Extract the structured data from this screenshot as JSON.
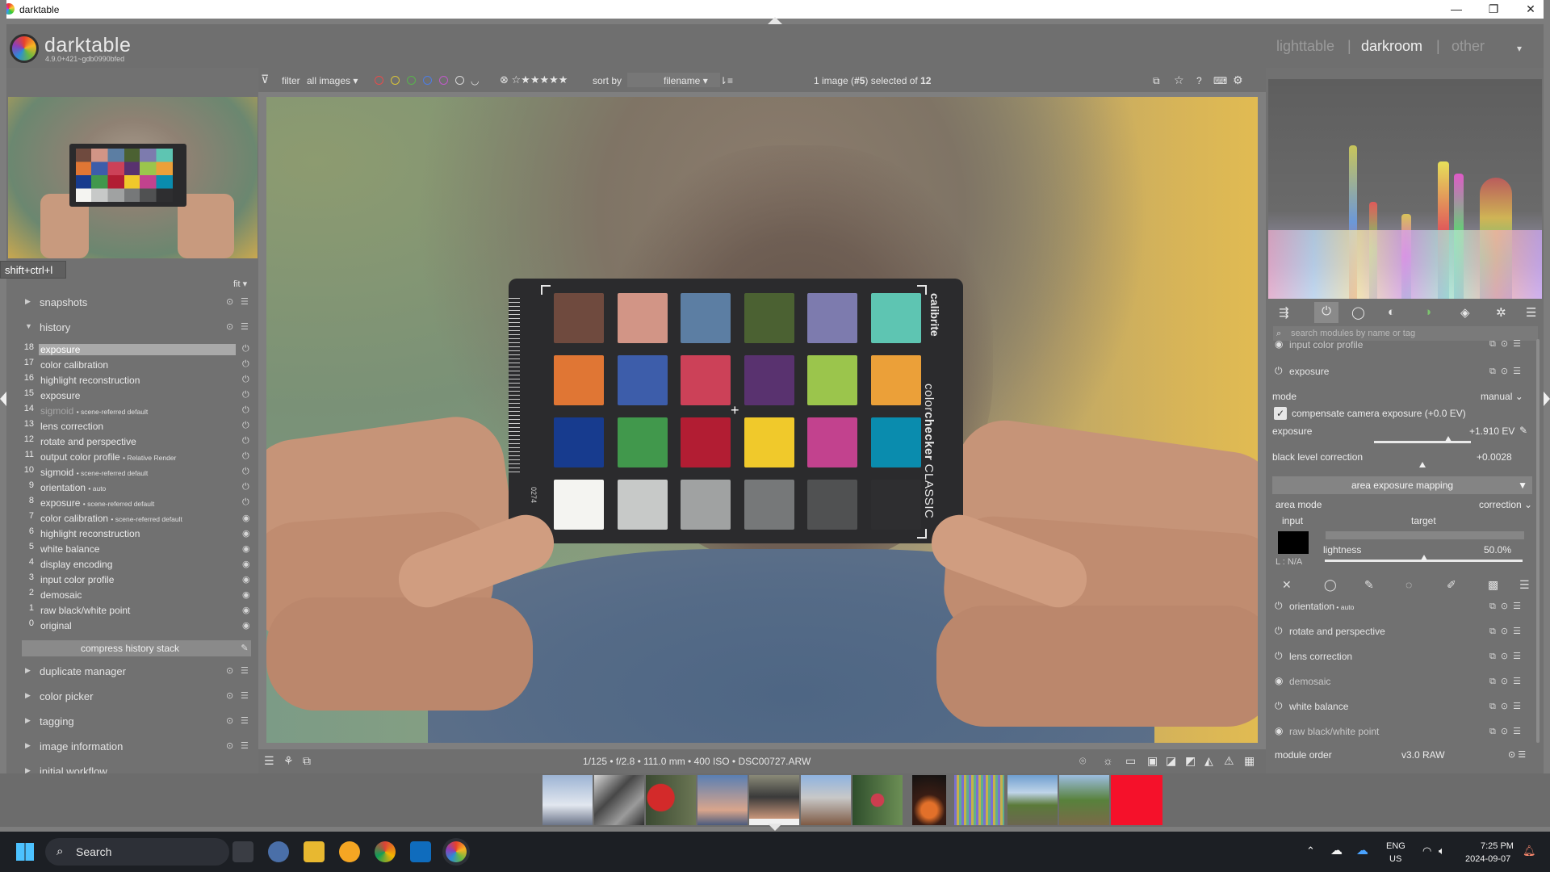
{
  "window": {
    "title": "darktable",
    "minimize": "—",
    "maximize": "❐",
    "close": "✕"
  },
  "header": {
    "app_name": "darktable",
    "version": "4.9.0+421~gdb0990bfed",
    "views": [
      "lighttable",
      "darkroom",
      "other"
    ],
    "active_view": "darkroom",
    "menu_icon": "▾"
  },
  "toolbar": {
    "filter_label": "filter",
    "filter_value": "all images",
    "sort_label": "sort by",
    "sort_value": "filename",
    "selection_prefix": "1 image (",
    "selection_num": "#5",
    "selection_mid": ") selected of ",
    "selection_total": "12",
    "color_labels": [
      "#e44d4d",
      "#d8c43a",
      "#59b44c",
      "#4d7de4",
      "#c05ac9"
    ],
    "stars": "☆★★★★★"
  },
  "left": {
    "tooltip": "shift+ctrl+l",
    "zoom": "fit",
    "snapshots": "snapshots",
    "history_title": "history",
    "history": [
      {
        "n": "18",
        "label": "exposure",
        "detail": "",
        "selected": true
      },
      {
        "n": "17",
        "label": "color calibration",
        "detail": ""
      },
      {
        "n": "16",
        "label": "highlight reconstruction",
        "detail": ""
      },
      {
        "n": "15",
        "label": "exposure",
        "detail": ""
      },
      {
        "n": "14",
        "label": "sigmoid",
        "detail": "scene-referred default",
        "dim": true
      },
      {
        "n": "13",
        "label": "lens correction",
        "detail": ""
      },
      {
        "n": "12",
        "label": "rotate and perspective",
        "detail": ""
      },
      {
        "n": "11",
        "label": "output color profile",
        "detail": "Relative Render"
      },
      {
        "n": "10",
        "label": "sigmoid",
        "detail": "scene-referred default"
      },
      {
        "n": "9",
        "label": "orientation",
        "detail": "auto"
      },
      {
        "n": "8",
        "label": "exposure",
        "detail": "scene-referred default"
      },
      {
        "n": "7",
        "label": "color calibration",
        "detail": "scene-referred default"
      },
      {
        "n": "6",
        "label": "highlight reconstruction",
        "detail": ""
      },
      {
        "n": "5",
        "label": "white balance",
        "detail": ""
      },
      {
        "n": "4",
        "label": "display encoding",
        "detail": ""
      },
      {
        "n": "3",
        "label": "input color profile",
        "detail": ""
      },
      {
        "n": "2",
        "label": "demosaic",
        "detail": ""
      },
      {
        "n": "1",
        "label": "raw black/white point",
        "detail": ""
      },
      {
        "n": "0",
        "label": "original",
        "detail": ""
      }
    ],
    "compress": "compress history stack",
    "collapsed_modules": [
      "duplicate manager",
      "color picker",
      "tagging",
      "image information",
      "initial workflow"
    ]
  },
  "bottom_info": "1/125 • f/2.8 • 111.0 mm • 400 ISO • DSC00727.ARW",
  "card": {
    "brand": "calibrite",
    "title_light": "color",
    "title_bold": "checker",
    "title_suffix": " CLASSIC",
    "number": "0274",
    "swatches": [
      [
        "#6f4a3e",
        "#d29586",
        "#5c7ea3",
        "#4b6132",
        "#7d7bae",
        "#5ec5b2"
      ],
      [
        "#e07634",
        "#3d5daa",
        "#cc4158",
        "#59326f",
        "#9bc54c",
        "#eba039"
      ],
      [
        "#173b8e",
        "#41984c",
        "#b21d33",
        "#f0c92b",
        "#c2428e",
        "#0a8cae"
      ],
      [
        "#f4f4f1",
        "#c7c9c8",
        "#a0a2a2",
        "#767879",
        "#505152",
        "#2e2e30"
      ]
    ]
  },
  "right": {
    "search_placeholder": "search modules by name or tag",
    "input_color_profile": "input color profile",
    "exposure": {
      "title": "exposure",
      "mode_label": "mode",
      "mode_value": "manual",
      "compensate": "compensate camera exposure (+0.0 EV)",
      "exposure_label": "exposure",
      "exposure_value": "+1.910 EV",
      "exposure_level": 0.77,
      "black_label": "black level correction",
      "black_value": "+0.0028",
      "black_level": 0.5,
      "aem_title": "area exposure mapping",
      "area_mode_label": "area mode",
      "area_mode_value": "correction",
      "input_label": "input",
      "target_label": "target",
      "lightness_label": "lightness",
      "lightness_value": "50.0%",
      "lightness_level": 0.5,
      "l_na_l": "L :",
      "l_na_v": "N/A"
    },
    "modules": [
      {
        "label": "orientation",
        "detail": "auto"
      },
      {
        "label": "rotate and perspective",
        "detail": ""
      },
      {
        "label": "lens correction",
        "detail": ""
      },
      {
        "label": "demosaic",
        "detail": "",
        "dim": true
      },
      {
        "label": "white balance",
        "detail": ""
      },
      {
        "label": "raw black/white point",
        "detail": "",
        "dim": true
      }
    ],
    "module_order_label": "module order",
    "module_order_value": "v3.0 RAW"
  },
  "taskbar": {
    "search": "Search",
    "lang1": "ENG",
    "lang2": "US",
    "time": "7:25 PM",
    "date": "2024-09-07"
  }
}
